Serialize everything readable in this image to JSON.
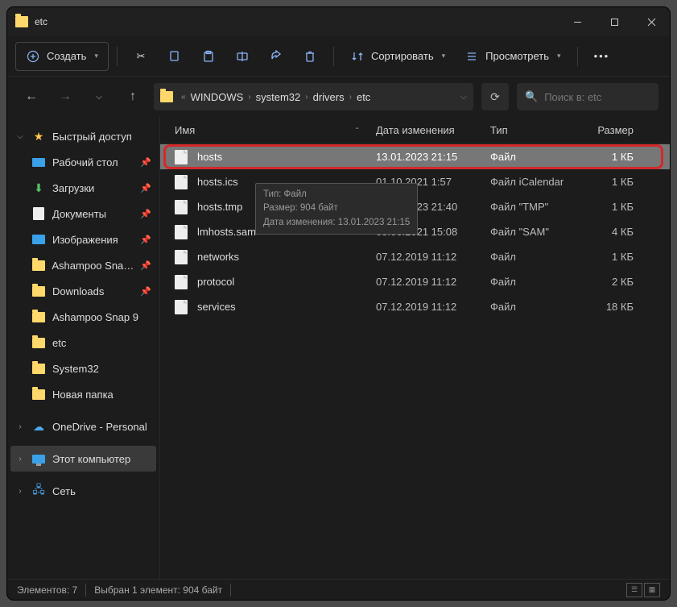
{
  "title": "etc",
  "toolbar": {
    "create": "Создать",
    "sort": "Сортировать",
    "view": "Просмотреть"
  },
  "breadcrumb": [
    "WINDOWS",
    "system32",
    "drivers",
    "etc"
  ],
  "search_placeholder": "Поиск в: etc",
  "sidebar": {
    "quick": "Быстрый доступ",
    "desktop": "Рабочий стол",
    "downloads": "Загрузки",
    "documents": "Документы",
    "pictures": "Изображения",
    "ashsnap": "Ashampoo Sna…",
    "downloads2": "Downloads",
    "ashsnap9": "Ashampoo Snap 9",
    "etc": "etc",
    "system32": "System32",
    "newfolder": "Новая папка",
    "onedrive": "OneDrive - Personal",
    "thispc": "Этот компьютер",
    "network": "Сеть"
  },
  "columns": {
    "name": "Имя",
    "date": "Дата изменения",
    "type": "Тип",
    "size": "Размер"
  },
  "files": [
    {
      "name": "hosts",
      "date": "13.01.2023 21:15",
      "type": "Файл",
      "size": "1 КБ",
      "sel": true
    },
    {
      "name": "hosts.ics",
      "date": "01.10.2021 1:57",
      "type": "Файл iCalendar",
      "size": "1 КБ"
    },
    {
      "name": "hosts.tmp",
      "date": "13.01.2023 21:40",
      "type": "Файл \"TMP\"",
      "size": "1 КБ"
    },
    {
      "name": "lmhosts.sam",
      "date": "05.06.2021 15:08",
      "type": "Файл \"SAM\"",
      "size": "4 КБ"
    },
    {
      "name": "networks",
      "date": "07.12.2019 11:12",
      "type": "Файл",
      "size": "1 КБ"
    },
    {
      "name": "protocol",
      "date": "07.12.2019 11:12",
      "type": "Файл",
      "size": "2 КБ"
    },
    {
      "name": "services",
      "date": "07.12.2019 11:12",
      "type": "Файл",
      "size": "18 КБ"
    }
  ],
  "tooltip": {
    "l1": "Тип: Файл",
    "l2": "Размер: 904 байт",
    "l3": "Дата изменения: 13.01.2023 21:15"
  },
  "status": {
    "count": "Элементов: 7",
    "sel": "Выбран 1 элемент: 904 байт"
  }
}
